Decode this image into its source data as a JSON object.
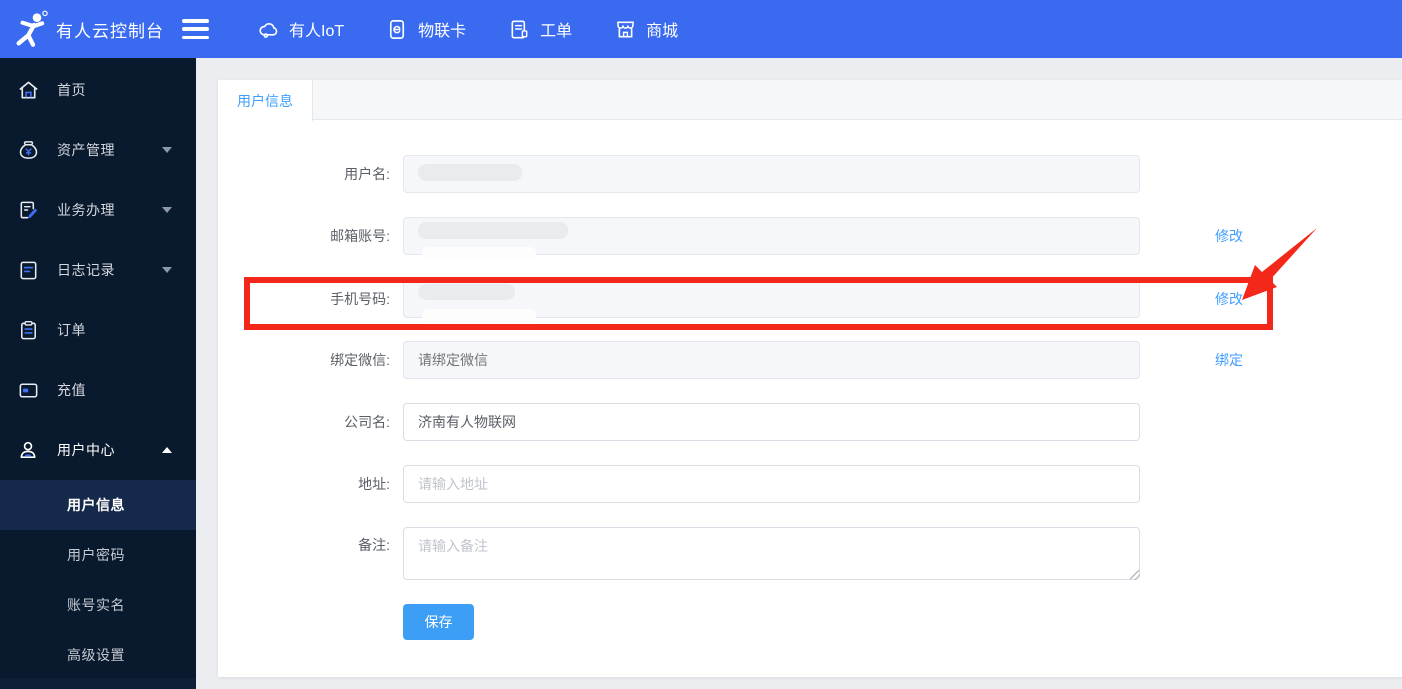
{
  "topbar": {
    "brand": "有人云控制台",
    "nav": [
      {
        "label": "有人IoT",
        "icon": "cloud-icon"
      },
      {
        "label": "物联卡",
        "icon": "sim-card-icon"
      },
      {
        "label": "工单",
        "icon": "work-order-icon"
      },
      {
        "label": "商城",
        "icon": "store-icon"
      }
    ]
  },
  "sidebar": {
    "items": [
      {
        "label": "首页",
        "icon": "home-icon",
        "has_submenu": false
      },
      {
        "label": "资产管理",
        "icon": "asset-icon",
        "has_submenu": true,
        "expanded": false
      },
      {
        "label": "业务办理",
        "icon": "business-icon",
        "has_submenu": true,
        "expanded": false
      },
      {
        "label": "日志记录",
        "icon": "log-icon",
        "has_submenu": true,
        "expanded": false
      },
      {
        "label": "订单",
        "icon": "order-icon",
        "has_submenu": false
      },
      {
        "label": "充值",
        "icon": "recharge-icon",
        "has_submenu": false
      },
      {
        "label": "用户中心",
        "icon": "user-icon",
        "has_submenu": true,
        "expanded": true
      }
    ],
    "submenu": [
      {
        "label": "用户信息",
        "active": true
      },
      {
        "label": "用户密码",
        "active": false
      },
      {
        "label": "账号实名",
        "active": false
      },
      {
        "label": "高级设置",
        "active": false
      }
    ]
  },
  "main": {
    "tab_label": "用户信息",
    "form": {
      "username_label": "用户名:",
      "email_label": "邮箱账号:",
      "phone_label": "手机号码:",
      "wechat_label": "绑定微信:",
      "wechat_placeholder": "请绑定微信",
      "company_label": "公司名:",
      "company_value": "济南有人物联网",
      "address_label": "地址:",
      "address_placeholder": "请输入地址",
      "remark_label": "备注:",
      "remark_placeholder": "请输入备注",
      "modify_email_link": "修改",
      "modify_phone_link": "修改",
      "bind_wechat_link": "绑定",
      "save_button": "保存"
    }
  },
  "colors": {
    "topbar_blue": "#3a6af0",
    "sidebar_navy": "#0a1a2e",
    "active_item_navy": "#152a4a",
    "link_blue": "#409eff",
    "save_button_blue": "#3d9ef6",
    "annotation_red": "#f4271b",
    "page_background": "#ebedf0"
  }
}
